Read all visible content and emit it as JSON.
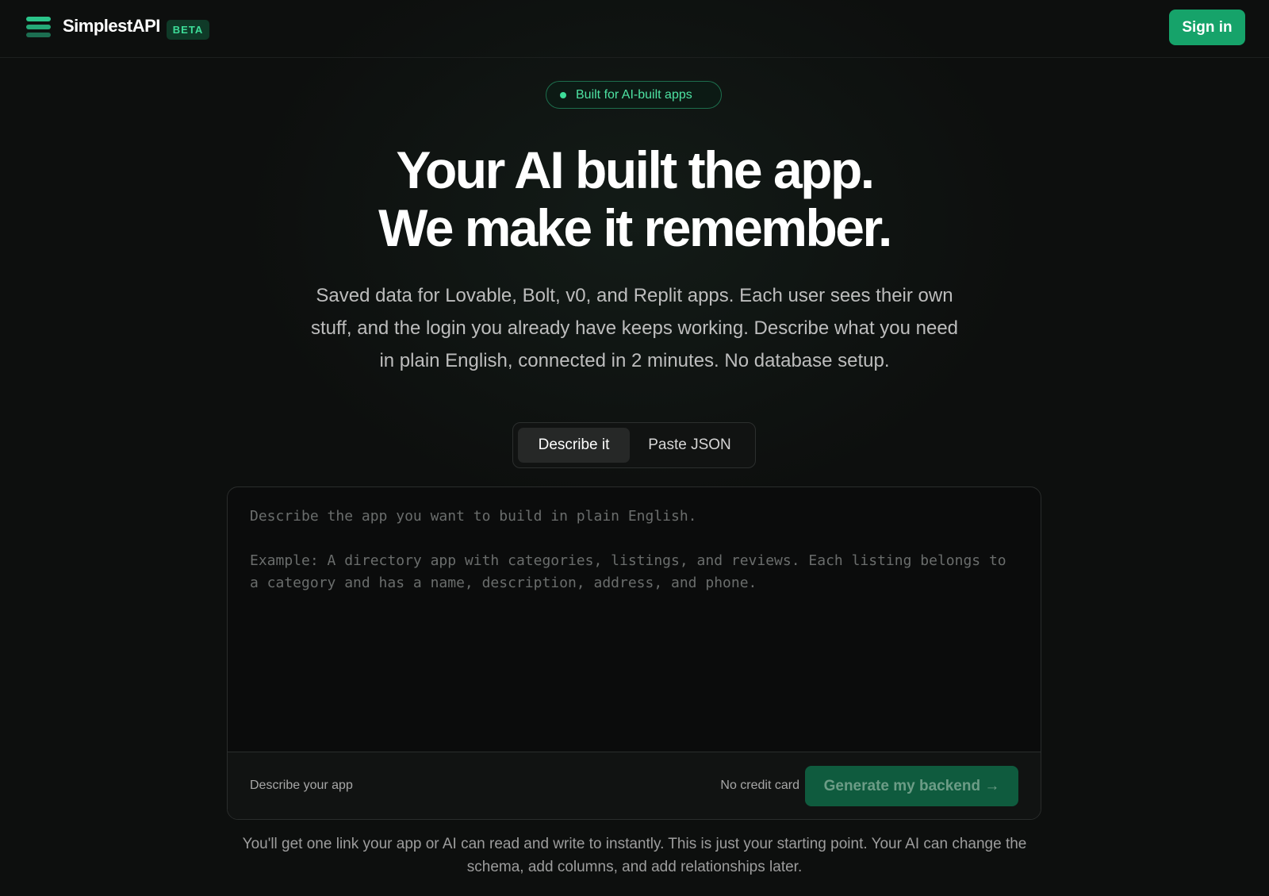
{
  "header": {
    "brand": "SimplestAPI",
    "badge": "BETA",
    "signin_label": "Sign in"
  },
  "hero": {
    "pill": "Built for AI-built apps",
    "title_line1": "Your AI built the app.",
    "title_line2": "We make it remember.",
    "subtitle": "Saved data for Lovable, Bolt, v0, and Replit apps. Each user sees their own stuff, and the login you already have keeps working. Describe what you need in plain English, connected in 2 minutes. No database setup."
  },
  "tabs": [
    {
      "label": "Describe it",
      "active": true
    },
    {
      "label": "Paste JSON",
      "active": false
    }
  ],
  "editor": {
    "value": "",
    "placeholder": "Describe the app you want to build in plain English.\n\nExample: A directory app with categories, listings, and reviews. Each listing belongs to a category and has a name, description, address, and phone."
  },
  "footer": {
    "hint": "Describe your app",
    "note": "No credit card",
    "generate_label": "Generate my backend →"
  },
  "bottom_note": "You'll get one link your app or AI can read and write to instantly. This is just your starting point. Your AI can change the schema, add columns, and add relationships later.",
  "colors": {
    "background": "#0d0f0e",
    "accent": "#16a36a",
    "accent_text": "#3ddc98",
    "generate_disabled": "#0f5b3e"
  },
  "icons": {
    "logo": "stacked-bars-icon",
    "pill_dot": "status-dot-icon"
  }
}
